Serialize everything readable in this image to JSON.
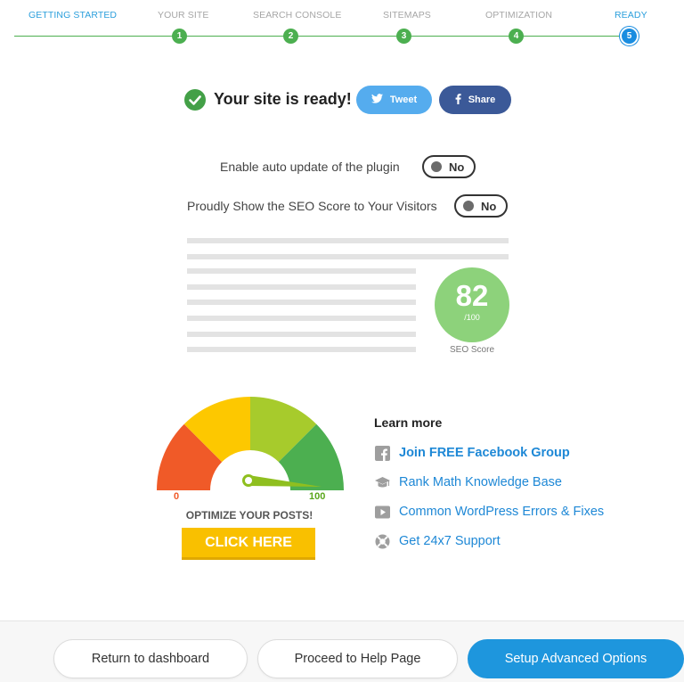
{
  "stepper": {
    "steps": [
      {
        "label": "GETTING STARTED",
        "number": ""
      },
      {
        "label": "YOUR SITE",
        "number": "1"
      },
      {
        "label": "SEARCH CONSOLE",
        "number": "2"
      },
      {
        "label": "SITEMAPS",
        "number": "3"
      },
      {
        "label": "OPTIMIZATION",
        "number": "4"
      },
      {
        "label": "READY",
        "number": "5"
      }
    ],
    "current_step": "5"
  },
  "ready": {
    "title": "Your site is ready!",
    "tweet_label": "Tweet",
    "share_label": "Share"
  },
  "toggles": {
    "auto_update": {
      "label": "Enable auto update of the plugin",
      "value": "No"
    },
    "seo_score": {
      "label": "Proudly Show the SEO Score to Your Visitors",
      "value": "No"
    }
  },
  "score": {
    "value": "82",
    "max": "/100",
    "caption": "SEO Score"
  },
  "banner": {
    "min": "0",
    "max": "100",
    "headline": "OPTIMIZE YOUR POSTS!",
    "cta": "CLICK HERE"
  },
  "learn_more": {
    "title": "Learn more",
    "items": [
      {
        "label": "Join FREE Facebook Group",
        "icon": "facebook-icon"
      },
      {
        "label": "Rank Math Knowledge Base",
        "icon": "graduation-cap-icon"
      },
      {
        "label": "Common WordPress Errors & Fixes",
        "icon": "video-play-icon"
      },
      {
        "label": "Get 24x7 Support",
        "icon": "lifebuoy-icon"
      }
    ]
  },
  "footer": {
    "return_label": "Return to dashboard",
    "help_label": "Proceed to Help Page",
    "advanced_label": "Setup Advanced Options"
  },
  "colors": {
    "accent": "#1e96dd",
    "success": "#4caf50",
    "score": "#8dd27b",
    "cta": "#f9c000"
  }
}
